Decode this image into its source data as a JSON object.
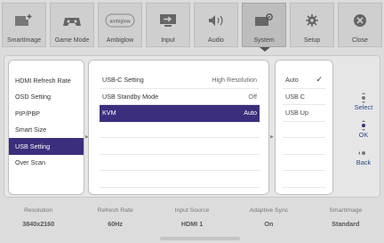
{
  "toolbar": [
    {
      "label": "SmartImage",
      "icon": "smartimage-icon",
      "active": false
    },
    {
      "label": "Game Mode",
      "icon": "gamepad-icon",
      "active": false
    },
    {
      "label": "Ambiglow",
      "icon": "ambiglow-icon",
      "active": false,
      "icon_text": "ambiglow"
    },
    {
      "label": "Input",
      "icon": "input-icon",
      "active": false
    },
    {
      "label": "Audio",
      "icon": "speaker-icon",
      "active": false
    },
    {
      "label": "System",
      "icon": "system-icon",
      "active": true
    },
    {
      "label": "Setup",
      "icon": "gear-icon",
      "active": false
    },
    {
      "label": "Close",
      "icon": "close-icon",
      "active": false
    }
  ],
  "left_menu": {
    "items": [
      "HDMI Refresh Rate",
      "OSD Setting",
      "PIP/PBP",
      "Smart Size",
      "USB Setting",
      "Over Scan"
    ],
    "selected": "USB Setting"
  },
  "settings": [
    {
      "label": "USB-C Setting",
      "value": "High Resolution"
    },
    {
      "label": "USB Standby Mode",
      "value": "Off"
    },
    {
      "label": "KVM",
      "value": "Auto",
      "highlighted": true
    },
    {
      "label": "",
      "value": ""
    },
    {
      "label": "",
      "value": ""
    },
    {
      "label": "",
      "value": ""
    },
    {
      "label": "",
      "value": ""
    }
  ],
  "options": {
    "items": [
      "Auto",
      "USB C",
      "USB Up",
      "",
      "",
      "",
      ""
    ],
    "checked": "Auto"
  },
  "nav": {
    "select": "Select",
    "ok": "OK",
    "back": "Back"
  },
  "status": [
    {
      "key": "Resolution",
      "value": "3840x2160"
    },
    {
      "key": "Refresh Rate",
      "value": "60Hz"
    },
    {
      "key": "Input Source",
      "value": "HDMI 1"
    },
    {
      "key": "Adaptive Sync",
      "value": "On"
    },
    {
      "key": "SmartImage",
      "value": "Standard"
    }
  ],
  "colors": {
    "accent": "#3b2f7d",
    "background": "#dcdcdc",
    "panel": "#ffffff"
  }
}
